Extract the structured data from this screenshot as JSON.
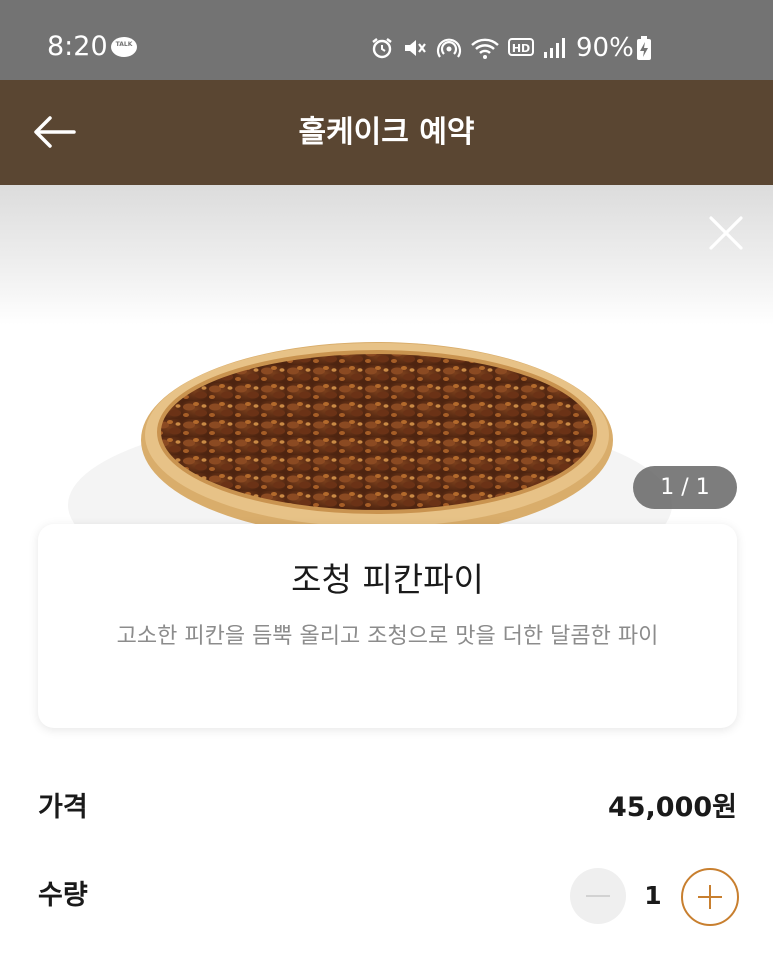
{
  "status_bar": {
    "time": "8:20",
    "talk_badge": "TALK",
    "battery": "90%",
    "icons": [
      "alarm-icon",
      "mute-icon",
      "hotspot-icon",
      "wifi-icon",
      "hd-voice-icon",
      "signal-icon",
      "battery-charging-icon"
    ]
  },
  "header": {
    "title": "홀케이크 예약",
    "back_icon": "arrow-left-icon"
  },
  "hero": {
    "close_icon": "close-icon",
    "page_indicator": "1 / 1"
  },
  "product": {
    "name": "조청 피칸파이",
    "description": "고소한 피칸을 듬뿍 올리고 조청으로 맛을 더한 달콤한 파이"
  },
  "price": {
    "label": "가격",
    "value": "45,000원"
  },
  "quantity": {
    "label": "수량",
    "value": "1",
    "minus_icon": "minus-icon",
    "plus_icon": "plus-icon"
  },
  "colors": {
    "status_bar": "#737373",
    "header": "#5a4632",
    "accent": "#c87f2f"
  }
}
